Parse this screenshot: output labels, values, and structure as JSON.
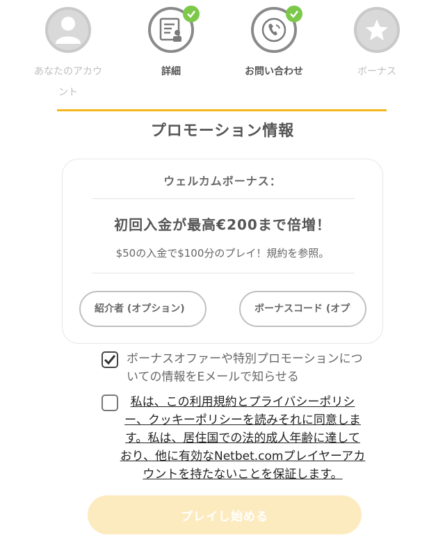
{
  "steps": [
    {
      "label": "あなたのアカウント",
      "icon": "user-icon",
      "state": "inactive"
    },
    {
      "label": "詳細",
      "icon": "document-icon",
      "state": "done"
    },
    {
      "label": "お問い合わせ",
      "icon": "phone-icon",
      "state": "done"
    },
    {
      "label": "ボーナス",
      "icon": "star-icon",
      "state": "inactive"
    }
  ],
  "section_title": "プロモーション情報",
  "card": {
    "bonus_label": "ウェルカムボーナス：",
    "headline": "初回入金が最高€200まで倍増！",
    "subtext": "$50の入金で$100分のプレイ！規約を参照。",
    "referrer_placeholder": "紹介者 (オプション)",
    "bonus_code_placeholder": "ボーナスコード (オプション)"
  },
  "consent": {
    "marketing_text": "ボーナスオファーや特別プロモーションについての情報をEメールで知らせる",
    "marketing_checked": true,
    "terms_text": "私は、この利用規約とプライバシーポリシー、クッキーポリシーを読みそれに同意します。私は、居住国での法的成人年齢に達しており、他に有効なNetbet.comプレイヤーアカウントを持たないことを保証します。",
    "terms_checked": false
  },
  "cta_label": "プレイし始める",
  "colors": {
    "accent_yellow": "#f3b61b",
    "check_green": "#7cc94a",
    "cta_disabled": "#fdebc0"
  }
}
